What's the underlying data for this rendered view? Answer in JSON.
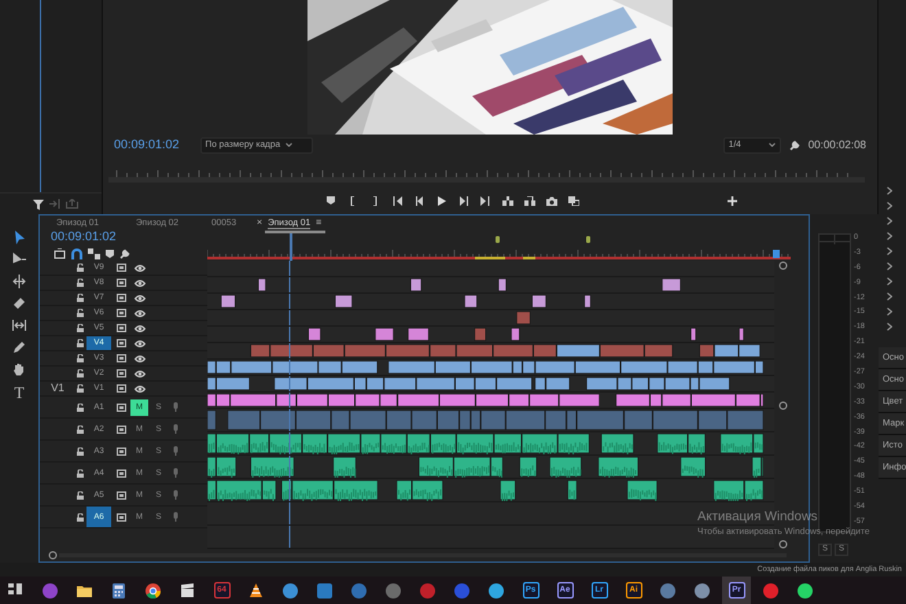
{
  "monitor": {
    "timecode": "00:09:01:02",
    "fit": "По размеру кадра",
    "resolution": "1/4",
    "duration": "00:00:02:08"
  },
  "tools": [
    {
      "kind": "selection",
      "selected": true
    },
    {
      "kind": "track-select",
      "selected": false
    },
    {
      "kind": "ripple",
      "selected": false
    },
    {
      "kind": "razor",
      "selected": false
    },
    {
      "kind": "slip",
      "selected": false
    },
    {
      "kind": "pen",
      "selected": false
    },
    {
      "kind": "hand",
      "selected": false
    },
    {
      "kind": "type",
      "glyph": "T",
      "selected": false
    }
  ],
  "timeline": {
    "tabs": [
      {
        "label": "Эпизод 01",
        "selected": false
      },
      {
        "label": "Эпизод 02",
        "selected": false
      },
      {
        "label": "00053",
        "selected": false
      },
      {
        "label": "Эпизод 01",
        "selected": true,
        "close": "×",
        "menu": "≡"
      }
    ],
    "timecode": "00:09:01:02",
    "snap": true,
    "tracks": [
      {
        "name": "V9",
        "kind": "video",
        "targeted": false
      },
      {
        "name": "V8",
        "kind": "video",
        "targeted": false
      },
      {
        "name": "V7",
        "kind": "video",
        "targeted": false
      },
      {
        "name": "V6",
        "kind": "video",
        "targeted": false
      },
      {
        "name": "V5",
        "kind": "video",
        "targeted": false
      },
      {
        "name": "V4",
        "kind": "video",
        "targeted": true
      },
      {
        "name": "V3",
        "kind": "video",
        "targeted": false
      },
      {
        "name": "V2",
        "kind": "video",
        "targeted": false
      },
      {
        "name": "V1",
        "kind": "video",
        "targeted": false,
        "source": "V1"
      },
      {
        "name": "A1",
        "kind": "audio",
        "targeted": false,
        "mute": true,
        "mute_label": "M",
        "solo_label": "S"
      },
      {
        "name": "A2",
        "kind": "audio",
        "targeted": false,
        "mute": false,
        "mute_label": "M",
        "solo_label": "S"
      },
      {
        "name": "A3",
        "kind": "audio",
        "targeted": false,
        "mute": false,
        "mute_label": "M",
        "solo_label": "S"
      },
      {
        "name": "A4",
        "kind": "audio",
        "targeted": false,
        "mute": false,
        "mute_label": "M",
        "solo_label": "S"
      },
      {
        "name": "A5",
        "kind": "audio",
        "targeted": false,
        "mute": false,
        "mute_label": "M",
        "solo_label": "S"
      },
      {
        "name": "A6",
        "kind": "audio",
        "targeted": true,
        "mute": false,
        "mute_label": "M",
        "solo_label": "S"
      }
    ]
  },
  "meter": {
    "scale": [
      "0",
      "-3",
      "-6",
      "-9",
      "-12",
      "-15",
      "-18",
      "-21",
      "-24",
      "-27",
      "-30",
      "-33",
      "-36",
      "-39",
      "-42",
      "-45",
      "-48",
      "-51",
      "-54",
      "-57"
    ],
    "solo": [
      "S",
      "S"
    ]
  },
  "side_panel": {
    "items": [
      "Осно",
      "Осно",
      "Цвет",
      "Марк",
      "Исто",
      "Инфо"
    ]
  },
  "activation": {
    "title": "Активация Windows",
    "text": "Чтобы активировать Windows, перейдите"
  },
  "status": "Создание файла пиков для Anglia Ruskin",
  "taskbar": [
    {
      "kind": "grid",
      "selected": false
    },
    {
      "kind": "circle",
      "color": "#8e44c8",
      "selected": false
    },
    {
      "kind": "folder",
      "selected": false
    },
    {
      "kind": "calculator",
      "selected": false
    },
    {
      "kind": "chrome",
      "selected": false
    },
    {
      "kind": "clapper",
      "selected": false
    },
    {
      "kind": "tile",
      "label": "64",
      "color": "#d8343a",
      "selected": false
    },
    {
      "kind": "cone",
      "selected": false
    },
    {
      "kind": "circle",
      "color": "#3b8fd4",
      "selected": false
    },
    {
      "kind": "square",
      "color": "#2a7ac0",
      "selected": false
    },
    {
      "kind": "circle",
      "color": "#2f6db0",
      "selected": false
    },
    {
      "kind": "circle",
      "color": "#6a6a6a",
      "selected": false
    },
    {
      "kind": "circle",
      "color": "#c0202a",
      "selected": false
    },
    {
      "kind": "circle",
      "color": "#2a4fd8",
      "selected": false
    },
    {
      "kind": "circle",
      "color": "#2ea6e0",
      "selected": false
    },
    {
      "kind": "tile",
      "label": "Ps",
      "color": "#31a8ff",
      "selected": false
    },
    {
      "kind": "tile",
      "label": "Ae",
      "color": "#9999ff",
      "selected": false
    },
    {
      "kind": "tile",
      "label": "Lr",
      "color": "#31a8ff",
      "selected": false
    },
    {
      "kind": "tile",
      "label": "Ai",
      "color": "#ff9a00",
      "selected": false
    },
    {
      "kind": "circle",
      "color": "#5a7aa0",
      "selected": false
    },
    {
      "kind": "circle",
      "color": "#7d8fa8",
      "selected": false
    },
    {
      "kind": "tile",
      "label": "Pr",
      "color": "#9999ff",
      "selected": true
    },
    {
      "kind": "circle",
      "color": "#e0202a",
      "selected": false
    },
    {
      "kind": "circle",
      "color": "#25d366",
      "selected": false
    }
  ]
}
